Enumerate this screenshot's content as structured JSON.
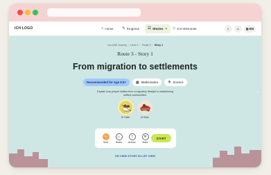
{
  "nav": {
    "logo": "ICH LOGO",
    "items": [
      {
        "label": "Home",
        "icon": "home-icon",
        "glyph": "⌂"
      },
      {
        "label": "Progress",
        "icon": "pencil-icon",
        "glyph": "✎"
      },
      {
        "label": "Stories",
        "icon": "sliders-icon",
        "glyph": "☷",
        "caret": "⌄"
      },
      {
        "label": "ICH Elements",
        "icon": "diamond-icon",
        "glyph": "◇"
      }
    ],
    "search_glyph": "⌕",
    "user_glyph": "☺",
    "language": {
      "code": "EN",
      "glyph": "◍"
    }
  },
  "breadcrumb": [
    "Our UAE Journey",
    "Level 1",
    "Route 3",
    "Story 1"
  ],
  "breadcrumb_separator": "›",
  "story": {
    "route_title": "Route 3 - Story 1",
    "title": "From migration to settlements",
    "age_tag": "Recommended for Age 6-9+",
    "subjects": [
      {
        "label": "Mathematics",
        "icon": "calculator-icon",
        "glyph": "▦"
      },
      {
        "label": "Science",
        "icon": "flask-icon",
        "glyph": "⚗"
      }
    ],
    "description": "Explain how people shifted from a migratory lifestyle to establishing settled communities.",
    "elements": [
      {
        "label": "Al Yolah",
        "icon": "al-yolah-image"
      },
      {
        "label": "Al Sadu",
        "icon": "al-sadu-image"
      }
    ]
  },
  "actions": [
    {
      "label": "Start",
      "icon": "pencil-icon",
      "glyph": "✎",
      "active": true
    },
    {
      "label": "Watch",
      "icon": "play-icon",
      "glyph": "▷",
      "active": false
    },
    {
      "label": "Answer",
      "icon": "question-icon",
      "glyph": "?",
      "active": false
    },
    {
      "label": "Make",
      "icon": "tools-icon",
      "glyph": "⚒",
      "active": false
    }
  ],
  "start_label": "START",
  "list_view_link": "OR VIEW STORY IN LIST VIEW",
  "colors": {
    "content_bg": "#cfe7e4",
    "age_tag": "#9fc7ff",
    "start_button": "#cbe654",
    "active_action": "#f5a34a",
    "link": "#2860b8",
    "chrome": "#f5d3d3"
  }
}
